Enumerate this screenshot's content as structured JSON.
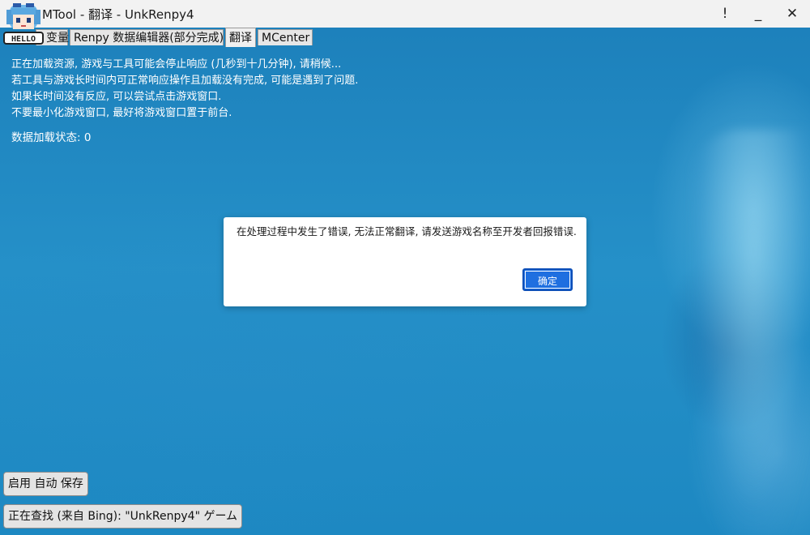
{
  "window": {
    "title": "MTool - 翻译 - UnkRenpy4",
    "logo_text": "HELLO",
    "alert_glyph": "!",
    "min_glyph": "_",
    "close_glyph": "✕"
  },
  "tabs": [
    {
      "label": "变量",
      "active": false
    },
    {
      "label": "Renpy 数据编辑器(部分完成)",
      "active": false
    },
    {
      "label": "翻译",
      "active": true
    },
    {
      "label": "MCenter",
      "active": false
    }
  ],
  "content": {
    "lines": [
      "正在加载资源, 游戏与工具可能会停止响应 (几秒到十几分钟), 请稍候...",
      "若工具与游戏长时间内可正常响应操作且加载没有完成, 可能是遇到了问题.",
      "如果长时间没有反应, 可以尝试点击游戏窗口.",
      "不要最小化游戏窗口, 最好将游戏窗口置于前台."
    ],
    "status": "数据加载状态: 0"
  },
  "dialog": {
    "message": "在处理过程中发生了错误, 无法正常翻译, 请发送游戏名称至开发者回报错误.",
    "ok_label": "确定"
  },
  "bottom": {
    "autosave_label": "启用 自动 保存",
    "search_label": "正在查找 (来自 Bing): \"UnkRenpy4\" ゲーム"
  },
  "colors": {
    "background": "#1e86c1",
    "accent_button": "#1f6fe0"
  }
}
